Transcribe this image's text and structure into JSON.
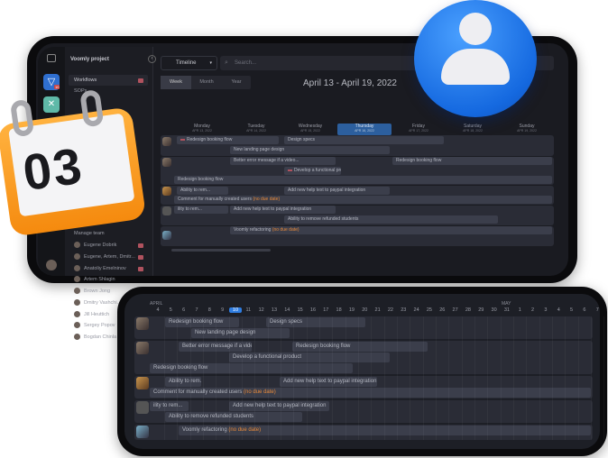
{
  "sidebar": {
    "project": "Voomly project",
    "items": [
      {
        "label": "Workflows"
      },
      {
        "label": "SOPs"
      }
    ],
    "manage_team": "Manage team",
    "members": [
      "Eugene Dobrik",
      "Eugene, Artem, Dmitr...",
      "Anatoliy Emelninov",
      "Artem Shlagin",
      "Brown Jong",
      "Dmitry Vashchi...",
      "Jill Heuttich",
      "Sergey Popov",
      "Bogdan Chinla"
    ],
    "app_badge": "10"
  },
  "toolbar": {
    "view_select": "Timeline",
    "search_placeholder": "Search..."
  },
  "tabs": [
    "Week",
    "Month",
    "Year"
  ],
  "date_range": "April 13 - April 19, 2022",
  "week_days": [
    {
      "name": "Monday",
      "date": "APR 13, 2022"
    },
    {
      "name": "Tuesday",
      "date": "APR 14, 2022"
    },
    {
      "name": "Wednesday",
      "date": "APR 15, 2022"
    },
    {
      "name": "Thursday",
      "date": "APR 16, 2022"
    },
    {
      "name": "Friday",
      "date": "APR 17, 2022"
    },
    {
      "name": "Saturday",
      "date": "APR 18, 2022"
    },
    {
      "name": "Sunday",
      "date": "APR 19, 2022"
    }
  ],
  "tasks": {
    "redesign": "Redesign booking flow",
    "specs": "Design specs",
    "landing": "New landing page design",
    "error": "Better error message if a video...",
    "develop": "Develop a functional product",
    "ability": "Ability to rem...",
    "ability_cut": "ility to rem...",
    "help": "Add new help text to paypal integration",
    "comment": "Comment for manually created users",
    "refund": "Ability to remove refunded students",
    "refactor": "Voomly refactoring",
    "no_due": "(no due date)"
  },
  "front": {
    "month1": "APRIL",
    "month2": "MAY",
    "today": "10",
    "days": [
      "4",
      "5",
      "6",
      "7",
      "8",
      "9",
      "10",
      "11",
      "12",
      "13",
      "14",
      "15",
      "16",
      "17",
      "18",
      "19",
      "20",
      "21",
      "22",
      "23",
      "24",
      "25",
      "26",
      "27",
      "28",
      "29",
      "30",
      "31",
      "1",
      "2",
      "3",
      "4",
      "5",
      "6",
      "7"
    ]
  },
  "calendar_icon": {
    "number": "03"
  },
  "colors": {
    "accent": "#2f7de1",
    "flag": "#b0525e",
    "no_due": "#e8893a",
    "calendar": "#ff9a1f",
    "user_icon": "#1e7bf0"
  }
}
